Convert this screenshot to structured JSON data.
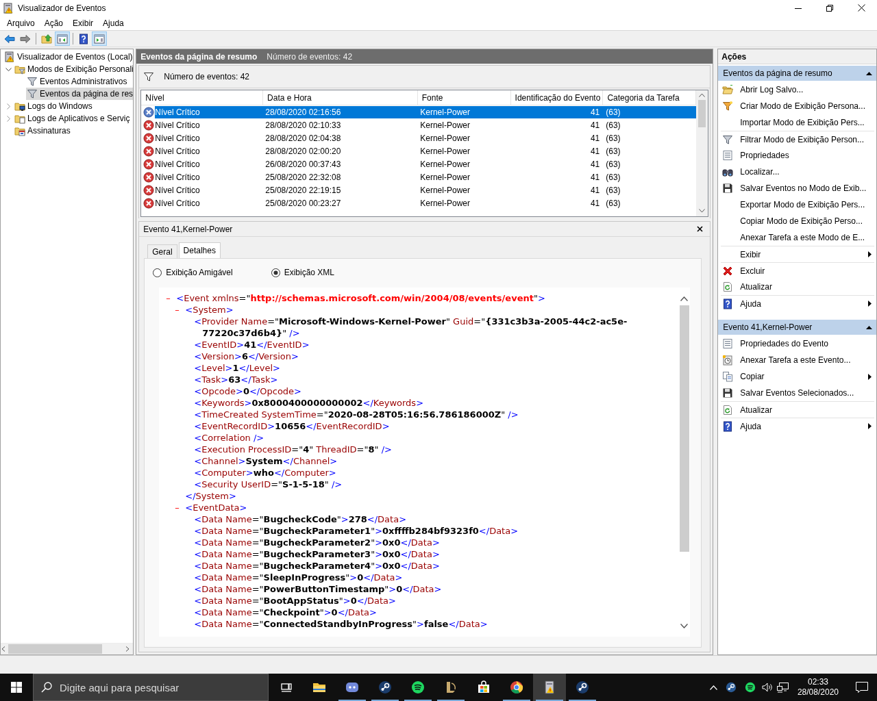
{
  "window": {
    "title": "Visualizador de Eventos"
  },
  "menu": [
    "Arquivo",
    "Ação",
    "Exibir",
    "Ajuda"
  ],
  "toolbar": [
    {
      "kind": "back",
      "pressed": false,
      "divider_before": false
    },
    {
      "kind": "forward",
      "pressed": false,
      "divider_before": false
    },
    {
      "kind": "folder-up",
      "pressed": false,
      "divider_before": true
    },
    {
      "kind": "pane-left",
      "pressed": true,
      "divider_before": false
    },
    {
      "kind": "help",
      "pressed": false,
      "divider_before": true
    },
    {
      "kind": "pane-right",
      "pressed": true,
      "divider_before": false
    }
  ],
  "tree": {
    "items": [
      {
        "label": "Visualizador de Eventos (Local)",
        "kind": "log",
        "selected": false,
        "children": [
          {
            "label": "Modos de Exibição Personali",
            "kind": "folder-filter",
            "expanded": true,
            "selected": false,
            "children": [
              {
                "label": "Eventos Administrativos",
                "kind": "filter",
                "selected": false
              },
              {
                "label": "Eventos da página de res",
                "kind": "filter",
                "selected": true
              }
            ]
          },
          {
            "label": "Logs do Windows",
            "kind": "folder-pc",
            "expanded": false,
            "selected": false
          },
          {
            "label": "Logs de Aplicativos e Serviç",
            "kind": "folder-doc",
            "expanded": false,
            "selected": false
          },
          {
            "label": "Assinaturas",
            "kind": "folder-sub",
            "selected": false
          }
        ]
      }
    ]
  },
  "summary": {
    "title": "Eventos da página de resumo",
    "count": "Número de eventos: 42",
    "filter_text": "Número de eventos: 42"
  },
  "table": {
    "columns": [
      "Nível",
      "Data e Hora",
      "Fonte",
      "Identificação do Evento",
      "Categoria da Tarefa"
    ],
    "rows": [
      {
        "selected": true,
        "cells": [
          "Nível Crítico",
          "28/08/2020 02:16:56",
          "Kernel-Power",
          "41",
          "(63)"
        ]
      },
      {
        "selected": false,
        "cells": [
          "Nível Crítico",
          "28/08/2020 02:10:33",
          "Kernel-Power",
          "41",
          "(63)"
        ]
      },
      {
        "selected": false,
        "cells": [
          "Nível Crítico",
          "28/08/2020 02:04:38",
          "Kernel-Power",
          "41",
          "(63)"
        ]
      },
      {
        "selected": false,
        "cells": [
          "Nível Crítico",
          "28/08/2020 02:00:20",
          "Kernel-Power",
          "41",
          "(63)"
        ]
      },
      {
        "selected": false,
        "cells": [
          "Nível Crítico",
          "26/08/2020 00:37:43",
          "Kernel-Power",
          "41",
          "(63)"
        ]
      },
      {
        "selected": false,
        "cells": [
          "Nível Crítico",
          "25/08/2020 22:32:08",
          "Kernel-Power",
          "41",
          "(63)"
        ]
      },
      {
        "selected": false,
        "cells": [
          "Nível Crítico",
          "25/08/2020 22:19:15",
          "Kernel-Power",
          "41",
          "(63)"
        ]
      },
      {
        "selected": false,
        "cells": [
          "Nível Crítico",
          "25/08/2020 00:23:27",
          "Kernel-Power",
          "41",
          "(63)"
        ]
      }
    ]
  },
  "detail": {
    "title": "Evento 41,Kernel-Power",
    "tabs": [
      {
        "label": "Geral",
        "selected": false
      },
      {
        "label": "Detalhes",
        "selected": true
      }
    ],
    "views": [
      {
        "label": "Exibição Amigável",
        "selected": false
      },
      {
        "label": "Exibição XML",
        "selected": true
      }
    ],
    "xml": {
      "toggle": "–",
      "expanded": true,
      "tokens": [
        {
          "kind": "p",
          "text": "<"
        },
        {
          "kind": "n",
          "text": "Event xmlns"
        },
        {
          "kind": "q",
          "text": "=\""
        },
        {
          "kind": "u",
          "text": "http://schemas.microsoft.com/win/2004/08/events/event"
        },
        {
          "kind": "q",
          "text": "\""
        },
        {
          "kind": "p",
          "text": ">"
        }
      ],
      "children": [
        {
          "toggle": "–",
          "expanded": true,
          "tokens": [
            {
              "kind": "p",
              "text": "<"
            },
            {
              "kind": "n",
              "text": "System"
            },
            {
              "kind": "p",
              "text": ">"
            }
          ],
          "end": [
            {
              "kind": "p",
              "text": "</"
            },
            {
              "kind": "n",
              "text": "System"
            },
            {
              "kind": "p",
              "text": ">"
            }
          ],
          "children": [
            {
              "tokens": [
                {
                  "kind": "p",
                  "text": "<"
                },
                {
                  "kind": "n",
                  "text": "Provider Name"
                },
                {
                  "kind": "q",
                  "text": "=\""
                },
                {
                  "kind": "v",
                  "text": "Microsoft-Windows-Kernel-Power"
                },
                {
                  "kind": "q",
                  "text": "\""
                },
                {
                  "kind": "n",
                  "text": " Guid"
                },
                {
                  "kind": "q",
                  "text": "=\""
                },
                {
                  "kind": "v",
                  "text": "{331c3b3a-2005-44c2-ac5e-"
                }
              ],
              "wrapped": [
                {
                  "kind": "v",
                  "text": "77220c37d6b4}"
                },
                {
                  "kind": "q",
                  "text": "\""
                },
                {
                  "kind": "p",
                  "text": " />"
                }
              ]
            },
            {
              "tokens": [
                {
                  "kind": "p",
                  "text": "<"
                },
                {
                  "kind": "n",
                  "text": "EventID"
                },
                {
                  "kind": "p",
                  "text": ">"
                },
                {
                  "kind": "v",
                  "text": "41"
                },
                {
                  "kind": "p",
                  "text": "</"
                },
                {
                  "kind": "n",
                  "text": "EventID"
                },
                {
                  "kind": "p",
                  "text": ">"
                }
              ]
            },
            {
              "tokens": [
                {
                  "kind": "p",
                  "text": "<"
                },
                {
                  "kind": "n",
                  "text": "Version"
                },
                {
                  "kind": "p",
                  "text": ">"
                },
                {
                  "kind": "v",
                  "text": "6"
                },
                {
                  "kind": "p",
                  "text": "</"
                },
                {
                  "kind": "n",
                  "text": "Version"
                },
                {
                  "kind": "p",
                  "text": ">"
                }
              ]
            },
            {
              "tokens": [
                {
                  "kind": "p",
                  "text": "<"
                },
                {
                  "kind": "n",
                  "text": "Level"
                },
                {
                  "kind": "p",
                  "text": ">"
                },
                {
                  "kind": "v",
                  "text": "1"
                },
                {
                  "kind": "p",
                  "text": "</"
                },
                {
                  "kind": "n",
                  "text": "Level"
                },
                {
                  "kind": "p",
                  "text": ">"
                }
              ]
            },
            {
              "tokens": [
                {
                  "kind": "p",
                  "text": "<"
                },
                {
                  "kind": "n",
                  "text": "Task"
                },
                {
                  "kind": "p",
                  "text": ">"
                },
                {
                  "kind": "v",
                  "text": "63"
                },
                {
                  "kind": "p",
                  "text": "</"
                },
                {
                  "kind": "n",
                  "text": "Task"
                },
                {
                  "kind": "p",
                  "text": ">"
                }
              ]
            },
            {
              "tokens": [
                {
                  "kind": "p",
                  "text": "<"
                },
                {
                  "kind": "n",
                  "text": "Opcode"
                },
                {
                  "kind": "p",
                  "text": ">"
                },
                {
                  "kind": "v",
                  "text": "0"
                },
                {
                  "kind": "p",
                  "text": "</"
                },
                {
                  "kind": "n",
                  "text": "Opcode"
                },
                {
                  "kind": "p",
                  "text": ">"
                }
              ]
            },
            {
              "tokens": [
                {
                  "kind": "p",
                  "text": "<"
                },
                {
                  "kind": "n",
                  "text": "Keywords"
                },
                {
                  "kind": "p",
                  "text": ">"
                },
                {
                  "kind": "v",
                  "text": "0x8000400000000002"
                },
                {
                  "kind": "p",
                  "text": "</"
                },
                {
                  "kind": "n",
                  "text": "Keywords"
                },
                {
                  "kind": "p",
                  "text": ">"
                }
              ]
            },
            {
              "tokens": [
                {
                  "kind": "p",
                  "text": "<"
                },
                {
                  "kind": "n",
                  "text": "TimeCreated SystemTime"
                },
                {
                  "kind": "q",
                  "text": "=\""
                },
                {
                  "kind": "v",
                  "text": "2020-08-28T05:16:56.786186000Z"
                },
                {
                  "kind": "q",
                  "text": "\""
                },
                {
                  "kind": "p",
                  "text": " />"
                }
              ]
            },
            {
              "tokens": [
                {
                  "kind": "p",
                  "text": "<"
                },
                {
                  "kind": "n",
                  "text": "EventRecordID"
                },
                {
                  "kind": "p",
                  "text": ">"
                },
                {
                  "kind": "v",
                  "text": "10656"
                },
                {
                  "kind": "p",
                  "text": "</"
                },
                {
                  "kind": "n",
                  "text": "EventRecordID"
                },
                {
                  "kind": "p",
                  "text": ">"
                }
              ]
            },
            {
              "tokens": [
                {
                  "kind": "p",
                  "text": "<"
                },
                {
                  "kind": "n",
                  "text": "Correlation"
                },
                {
                  "kind": "p",
                  "text": " />"
                }
              ]
            },
            {
              "tokens": [
                {
                  "kind": "p",
                  "text": "<"
                },
                {
                  "kind": "n",
                  "text": "Execution ProcessID"
                },
                {
                  "kind": "q",
                  "text": "=\""
                },
                {
                  "kind": "v",
                  "text": "4"
                },
                {
                  "kind": "q",
                  "text": "\""
                },
                {
                  "kind": "n",
                  "text": " ThreadID"
                },
                {
                  "kind": "q",
                  "text": "=\""
                },
                {
                  "kind": "v",
                  "text": "8"
                },
                {
                  "kind": "q",
                  "text": "\""
                },
                {
                  "kind": "p",
                  "text": " />"
                }
              ]
            },
            {
              "tokens": [
                {
                  "kind": "p",
                  "text": "<"
                },
                {
                  "kind": "n",
                  "text": "Channel"
                },
                {
                  "kind": "p",
                  "text": ">"
                },
                {
                  "kind": "v",
                  "text": "System"
                },
                {
                  "kind": "p",
                  "text": "</"
                },
                {
                  "kind": "n",
                  "text": "Channel"
                },
                {
                  "kind": "p",
                  "text": ">"
                }
              ]
            },
            {
              "tokens": [
                {
                  "kind": "p",
                  "text": "<"
                },
                {
                  "kind": "n",
                  "text": "Computer"
                },
                {
                  "kind": "p",
                  "text": ">"
                },
                {
                  "kind": "v",
                  "text": "who"
                },
                {
                  "kind": "p",
                  "text": "</"
                },
                {
                  "kind": "n",
                  "text": "Computer"
                },
                {
                  "kind": "p",
                  "text": ">"
                }
              ]
            },
            {
              "tokens": [
                {
                  "kind": "p",
                  "text": "<"
                },
                {
                  "kind": "n",
                  "text": "Security UserID"
                },
                {
                  "kind": "q",
                  "text": "=\""
                },
                {
                  "kind": "v",
                  "text": "S-1-5-18"
                },
                {
                  "kind": "q",
                  "text": "\""
                },
                {
                  "kind": "p",
                  "text": " />"
                }
              ]
            }
          ]
        },
        {
          "toggle": "–",
          "expanded": true,
          "tokens": [
            {
              "kind": "p",
              "text": "<"
            },
            {
              "kind": "n",
              "text": "EventData"
            },
            {
              "kind": "p",
              "text": ">"
            }
          ],
          "children": [
            {
              "tokens": [
                {
                  "kind": "p",
                  "text": "<"
                },
                {
                  "kind": "n",
                  "text": "Data Name"
                },
                {
                  "kind": "q",
                  "text": "=\""
                },
                {
                  "kind": "v",
                  "text": "BugcheckCode"
                },
                {
                  "kind": "q",
                  "text": "\""
                },
                {
                  "kind": "p",
                  "text": ">"
                },
                {
                  "kind": "v",
                  "text": "278"
                },
                {
                  "kind": "p",
                  "text": "</"
                },
                {
                  "kind": "n",
                  "text": "Data"
                },
                {
                  "kind": "p",
                  "text": ">"
                }
              ]
            },
            {
              "tokens": [
                {
                  "kind": "p",
                  "text": "<"
                },
                {
                  "kind": "n",
                  "text": "Data Name"
                },
                {
                  "kind": "q",
                  "text": "=\""
                },
                {
                  "kind": "v",
                  "text": "BugcheckParameter1"
                },
                {
                  "kind": "q",
                  "text": "\""
                },
                {
                  "kind": "p",
                  "text": ">"
                },
                {
                  "kind": "v",
                  "text": "0xffffb284bf9323f0"
                },
                {
                  "kind": "p",
                  "text": "</"
                },
                {
                  "kind": "n",
                  "text": "Data"
                },
                {
                  "kind": "p",
                  "text": ">"
                }
              ]
            },
            {
              "tokens": [
                {
                  "kind": "p",
                  "text": "<"
                },
                {
                  "kind": "n",
                  "text": "Data Name"
                },
                {
                  "kind": "q",
                  "text": "=\""
                },
                {
                  "kind": "v",
                  "text": "BugcheckParameter2"
                },
                {
                  "kind": "q",
                  "text": "\""
                },
                {
                  "kind": "p",
                  "text": ">"
                },
                {
                  "kind": "v",
                  "text": "0x0"
                },
                {
                  "kind": "p",
                  "text": "</"
                },
                {
                  "kind": "n",
                  "text": "Data"
                },
                {
                  "kind": "p",
                  "text": ">"
                }
              ]
            },
            {
              "tokens": [
                {
                  "kind": "p",
                  "text": "<"
                },
                {
                  "kind": "n",
                  "text": "Data Name"
                },
                {
                  "kind": "q",
                  "text": "=\""
                },
                {
                  "kind": "v",
                  "text": "BugcheckParameter3"
                },
                {
                  "kind": "q",
                  "text": "\""
                },
                {
                  "kind": "p",
                  "text": ">"
                },
                {
                  "kind": "v",
                  "text": "0x0"
                },
                {
                  "kind": "p",
                  "text": "</"
                },
                {
                  "kind": "n",
                  "text": "Data"
                },
                {
                  "kind": "p",
                  "text": ">"
                }
              ]
            },
            {
              "tokens": [
                {
                  "kind": "p",
                  "text": "<"
                },
                {
                  "kind": "n",
                  "text": "Data Name"
                },
                {
                  "kind": "q",
                  "text": "=\""
                },
                {
                  "kind": "v",
                  "text": "BugcheckParameter4"
                },
                {
                  "kind": "q",
                  "text": "\""
                },
                {
                  "kind": "p",
                  "text": ">"
                },
                {
                  "kind": "v",
                  "text": "0x0"
                },
                {
                  "kind": "p",
                  "text": "</"
                },
                {
                  "kind": "n",
                  "text": "Data"
                },
                {
                  "kind": "p",
                  "text": ">"
                }
              ]
            },
            {
              "tokens": [
                {
                  "kind": "p",
                  "text": "<"
                },
                {
                  "kind": "n",
                  "text": "Data Name"
                },
                {
                  "kind": "q",
                  "text": "=\""
                },
                {
                  "kind": "v",
                  "text": "SleepInProgress"
                },
                {
                  "kind": "q",
                  "text": "\""
                },
                {
                  "kind": "p",
                  "text": ">"
                },
                {
                  "kind": "v",
                  "text": "0"
                },
                {
                  "kind": "p",
                  "text": "</"
                },
                {
                  "kind": "n",
                  "text": "Data"
                },
                {
                  "kind": "p",
                  "text": ">"
                }
              ]
            },
            {
              "tokens": [
                {
                  "kind": "p",
                  "text": "<"
                },
                {
                  "kind": "n",
                  "text": "Data Name"
                },
                {
                  "kind": "q",
                  "text": "=\""
                },
                {
                  "kind": "v",
                  "text": "PowerButtonTimestamp"
                },
                {
                  "kind": "q",
                  "text": "\""
                },
                {
                  "kind": "p",
                  "text": ">"
                },
                {
                  "kind": "v",
                  "text": "0"
                },
                {
                  "kind": "p",
                  "text": "</"
                },
                {
                  "kind": "n",
                  "text": "Data"
                },
                {
                  "kind": "p",
                  "text": ">"
                }
              ]
            },
            {
              "tokens": [
                {
                  "kind": "p",
                  "text": "<"
                },
                {
                  "kind": "n",
                  "text": "Data Name"
                },
                {
                  "kind": "q",
                  "text": "=\""
                },
                {
                  "kind": "v",
                  "text": "BootAppStatus"
                },
                {
                  "kind": "q",
                  "text": "\""
                },
                {
                  "kind": "p",
                  "text": ">"
                },
                {
                  "kind": "v",
                  "text": "0"
                },
                {
                  "kind": "p",
                  "text": "</"
                },
                {
                  "kind": "n",
                  "text": "Data"
                },
                {
                  "kind": "p",
                  "text": ">"
                }
              ]
            },
            {
              "tokens": [
                {
                  "kind": "p",
                  "text": "<"
                },
                {
                  "kind": "n",
                  "text": "Data Name"
                },
                {
                  "kind": "q",
                  "text": "=\""
                },
                {
                  "kind": "v",
                  "text": "Checkpoint"
                },
                {
                  "kind": "q",
                  "text": "\""
                },
                {
                  "kind": "p",
                  "text": ">"
                },
                {
                  "kind": "v",
                  "text": "0"
                },
                {
                  "kind": "p",
                  "text": "</"
                },
                {
                  "kind": "n",
                  "text": "Data"
                },
                {
                  "kind": "p",
                  "text": ">"
                }
              ]
            },
            {
              "tokens": [
                {
                  "kind": "p",
                  "text": "<"
                },
                {
                  "kind": "n",
                  "text": "Data Name"
                },
                {
                  "kind": "q",
                  "text": "=\""
                },
                {
                  "kind": "v",
                  "text": "ConnectedStandbyInProgress"
                },
                {
                  "kind": "q",
                  "text": "\""
                },
                {
                  "kind": "p",
                  "text": ">"
                },
                {
                  "kind": "v",
                  "text": "false"
                },
                {
                  "kind": "p",
                  "text": "</"
                },
                {
                  "kind": "n",
                  "text": "Data"
                },
                {
                  "kind": "p",
                  "text": ">"
                }
              ]
            }
          ]
        }
      ]
    }
  },
  "actions": {
    "title": "Ações",
    "sections": [
      {
        "title": "Eventos da página de resumo",
        "expanded": true,
        "items": [
          {
            "label": "Abrir Log Salvo...",
            "kind": "open-folder",
            "submenu": false,
            "divider_before": false
          },
          {
            "label": "Criar Modo de Exibição Persona...",
            "kind": "filter-star",
            "submenu": false,
            "divider_before": false
          },
          {
            "label": "Importar Modo de Exibição Pers...",
            "kind": "none",
            "submenu": false,
            "divider_before": false
          },
          {
            "label": "Filtrar Modo de Exibição Person...",
            "kind": "filter",
            "submenu": false,
            "divider_before": true
          },
          {
            "label": "Propriedades",
            "kind": "properties",
            "submenu": false,
            "divider_before": false
          },
          {
            "label": "Localizar...",
            "kind": "binoculars",
            "submenu": false,
            "divider_before": false
          },
          {
            "label": "Salvar Eventos no Modo de Exib...",
            "kind": "floppy",
            "submenu": false,
            "divider_before": false
          },
          {
            "label": "Exportar Modo de Exibição Pers...",
            "kind": "none",
            "submenu": false,
            "divider_before": false
          },
          {
            "label": "Copiar Modo de Exibição Perso...",
            "kind": "none",
            "submenu": false,
            "divider_before": false
          },
          {
            "label": "Anexar Tarefa a este Modo de E...",
            "kind": "none",
            "submenu": false,
            "divider_before": false
          },
          {
            "label": "Exibir",
            "kind": "none",
            "submenu": true,
            "divider_before": true
          },
          {
            "label": "Excluir",
            "kind": "delete",
            "submenu": false,
            "divider_before": true
          },
          {
            "label": "Atualizar",
            "kind": "refresh",
            "submenu": false,
            "divider_before": false
          },
          {
            "label": "Ajuda",
            "kind": "help",
            "submenu": true,
            "divider_before": true
          }
        ]
      },
      {
        "title": "Evento 41,Kernel-Power",
        "expanded": true,
        "items": [
          {
            "label": "Propriedades do Evento",
            "kind": "properties",
            "submenu": false,
            "divider_before": false
          },
          {
            "label": "Anexar Tarefa a este Evento...",
            "kind": "task",
            "submenu": false,
            "divider_before": false
          },
          {
            "label": "Copiar",
            "kind": "copy",
            "submenu": true,
            "divider_before": false
          },
          {
            "label": "Salvar Eventos Selecionados...",
            "kind": "floppy",
            "submenu": false,
            "divider_before": false
          },
          {
            "label": "Atualizar",
            "kind": "refresh",
            "submenu": false,
            "divider_before": true
          },
          {
            "label": "Ajuda",
            "kind": "help",
            "submenu": true,
            "divider_before": true
          }
        ]
      }
    ]
  },
  "taskbar": {
    "search_placeholder": "Digite aqui para pesquisar",
    "apps": [
      {
        "kind": "task-view",
        "running": false,
        "selected": false
      },
      {
        "kind": "explorer",
        "running": false,
        "selected": false
      },
      {
        "kind": "chat",
        "running": true,
        "selected": false
      },
      {
        "kind": "steam",
        "running": true,
        "selected": false
      },
      {
        "kind": "music",
        "running": true,
        "selected": false
      },
      {
        "kind": "game",
        "running": true,
        "selected": false
      },
      {
        "kind": "store",
        "running": false,
        "selected": false
      },
      {
        "kind": "browser",
        "running": true,
        "selected": false
      },
      {
        "kind": "log",
        "running": true,
        "selected": true
      },
      {
        "kind": "steam",
        "running": true,
        "selected": false
      }
    ],
    "time": "02:33",
    "date": "28/08/2020"
  }
}
